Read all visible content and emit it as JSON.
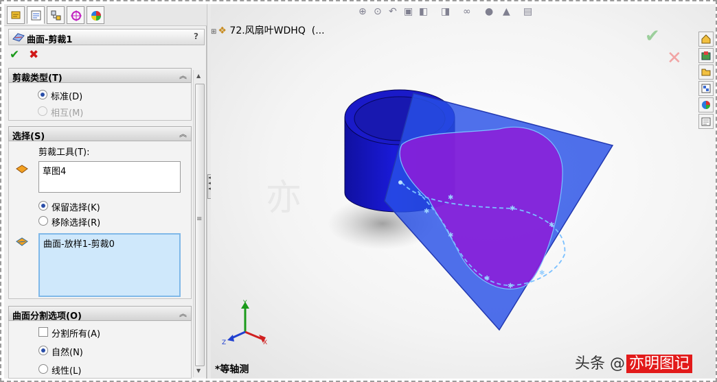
{
  "property_manager": {
    "tabs": [
      "feature-manager-icon",
      "property-manager-icon",
      "configuration-manager-icon",
      "dimxpert-icon",
      "display-manager-icon"
    ],
    "title": "曲面-剪裁1",
    "help": "?",
    "trim_type": {
      "header": "剪裁类型(T)",
      "options": [
        {
          "label": "标准(D)",
          "selected": true,
          "enabled": true
        },
        {
          "label": "相互(M)",
          "selected": false,
          "enabled": false
        }
      ]
    },
    "selection": {
      "header": "选择(S)",
      "trim_tool_label": "剪裁工具(T):",
      "trim_tool_value": "草图4",
      "keep_remove": [
        {
          "label": "保留选择(K)",
          "selected": true
        },
        {
          "label": "移除选择(R)",
          "selected": false
        }
      ],
      "pieces_value": "曲面-放样1-剪裁0"
    },
    "split_options": {
      "header": "曲面分割选项(O)",
      "split_all": {
        "label": "分割所有(A)",
        "checked": false
      },
      "options": [
        {
          "label": "自然(N)",
          "selected": true
        },
        {
          "label": "线性(L)",
          "selected": false
        }
      ]
    }
  },
  "graphics": {
    "document_title": "72.风扇叶WDHQ  (...",
    "view_label": "*等轴测",
    "triad": {
      "x": "X",
      "y": "Y",
      "z": "Z"
    },
    "watermark_prefix": "头条 @",
    "watermark_name": "亦明图记",
    "colors": {
      "cylinder": "#1414c8",
      "plane": "#2850e6",
      "surface": "#8c1ed8",
      "sketch": "#6fb8ff"
    }
  }
}
